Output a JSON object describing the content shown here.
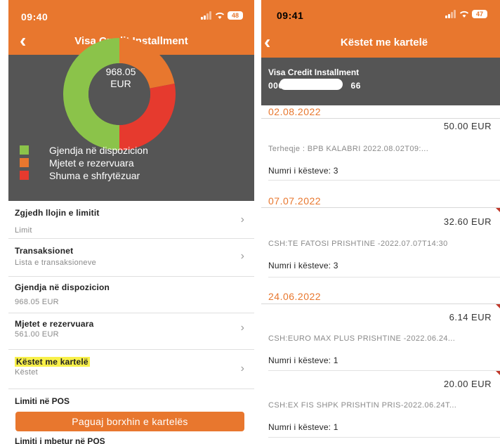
{
  "left": {
    "status": {
      "time": "09:40",
      "battery": "48"
    },
    "title": "Visa Credit Installment",
    "donut": {
      "amount": "968.05",
      "currency": "EUR",
      "fractions": [
        0.5,
        0.22,
        0.28
      ],
      "colors": [
        "#8bc34a",
        "#e8772e",
        "#e63a2e"
      ]
    },
    "legend": [
      {
        "label": "Gjendja në dispozicion",
        "color": "#8bc34a"
      },
      {
        "label": "Mjetet e rezervuara",
        "color": "#e8772e"
      },
      {
        "label": "Shuma e shfrytëzuar",
        "color": "#e63a2e"
      }
    ],
    "items": [
      {
        "label": "Zgjedh llojin e limitit",
        "sub": "Limit"
      },
      {
        "label": "Transaksionet",
        "sub": "Lista e transaksioneve"
      },
      {
        "label": "Gjendja në dispozicion",
        "sub": "968.05 EUR"
      },
      {
        "label": "Mjetet e rezervuara",
        "sub": "561.00 EUR"
      },
      {
        "label": "Këstet me kartelë",
        "sub": "Këstet"
      },
      {
        "label": "Limiti në POS"
      }
    ],
    "pay_button": "Paguaj borxhin e kartelës",
    "tail": "Limiti i mbetur në POS"
  },
  "right": {
    "status": {
      "time": "09:41",
      "battery": "47"
    },
    "title": "Këstet me kartelë",
    "card": {
      "name": "Visa Credit Installment",
      "number_start": "006",
      "number_end": "66"
    },
    "groups": [
      {
        "date": "02.08.2022",
        "entries": [
          {
            "amount": "50.00  EUR",
            "desc": "Terheqje : BPB KALABRI    2022.08.02T09:...",
            "count": "Numri i kësteve: 3"
          }
        ]
      },
      {
        "date": "07.07.2022",
        "entries": [
          {
            "amount": "32.60  EUR",
            "desc": "CSH:TE FATOSI PRISHTINE -2022.07.07T14:30",
            "count": "Numri i kësteve: 3"
          }
        ]
      },
      {
        "date": "24.06.2022",
        "entries": [
          {
            "amount": "6.14  EUR",
            "desc": "CSH:EURO MAX PLUS PRISHTINE -2022.06.24...",
            "count": "Numri i kësteve: 1"
          },
          {
            "amount": "20.00  EUR",
            "desc": "CSH:EX FIS SHPK PRISHTIN PRIS-2022.06.24T...",
            "count": "Numri i kësteve: 1"
          }
        ]
      }
    ]
  }
}
